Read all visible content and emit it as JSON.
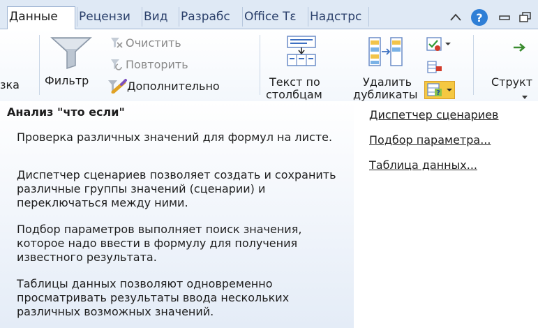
{
  "tabs": [
    {
      "label": "Данные",
      "active": true
    },
    {
      "label": "Рецензи",
      "active": false
    },
    {
      "label": "Вид",
      "active": false
    },
    {
      "label": "Разрабс",
      "active": false
    },
    {
      "label": "Office Tε",
      "active": false
    },
    {
      "label": "Надстрс",
      "active": false
    }
  ],
  "window_icons": [
    "ribbon-collapse-icon",
    "help-icon",
    "minimize-icon",
    "restore-icon"
  ],
  "ribbon": {
    "left_partial": "зка",
    "filter_label": "Фильтр",
    "clear_label": "Очистить",
    "reapply_label": "Повторить",
    "advanced_label": "Дополнительно",
    "text_to_columns_line1": "Текст по",
    "text_to_columns_line2": "столбцам",
    "remove_dup_line1": "Удалить",
    "remove_dup_line2": "дубликаты",
    "outline_label": "Структ"
  },
  "tooltip": {
    "title": "Анализ \"что если\"",
    "paragraphs": [
      "Проверка различных значений для формул на листе.",
      "Диспетчер сценариев позволяет создать и сохранить различные группы значений (сценарии) и переключаться между ними.",
      "Подбор параметров выполняет поиск значения, которое надо ввести в формулу для получения известного результата.",
      "Таблицы данных позволяют одновременно просматривать результаты ввода нескольких различных возможных значений."
    ]
  },
  "menu": {
    "items": [
      {
        "label": "Диспетчер сценариев"
      },
      {
        "label": "Подбор параметра..."
      },
      {
        "label": "Таблица данных..."
      }
    ]
  },
  "colors": {
    "accent": "#f5c842",
    "tab_bar": "#dfe9f5",
    "help_blue": "#2f7fd6"
  }
}
